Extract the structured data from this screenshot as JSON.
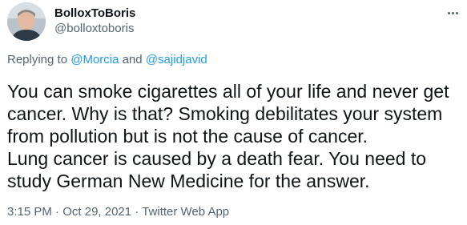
{
  "author": {
    "name": "BolloxToBoris",
    "handle": "@bolloxtoboris"
  },
  "more_icon": "more-horizontal-icon",
  "replying": {
    "prefix": "Replying to ",
    "mention_1": "@Morcia",
    "conjunction": " and ",
    "mention_2": "@sajidjavid"
  },
  "tweet": {
    "line_1": "You can smoke cigarettes all of your life and never get",
    "line_2": "cancer.  Why is that?  Smoking debilitates your system",
    "line_3": "from pollution but is not the cause of cancer.",
    "line_4": "Lung cancer is caused by a death fear.  You need to",
    "line_5": "study German New Medicine for the answer."
  },
  "meta": {
    "time": "3:15 PM",
    "separator_1": " · ",
    "date": "Oct 29, 2021",
    "separator_2": " · ",
    "source": "Twitter Web App"
  },
  "colors": {
    "text": "#0f1419",
    "secondary": "#536471",
    "link": "#1d9bf0"
  }
}
